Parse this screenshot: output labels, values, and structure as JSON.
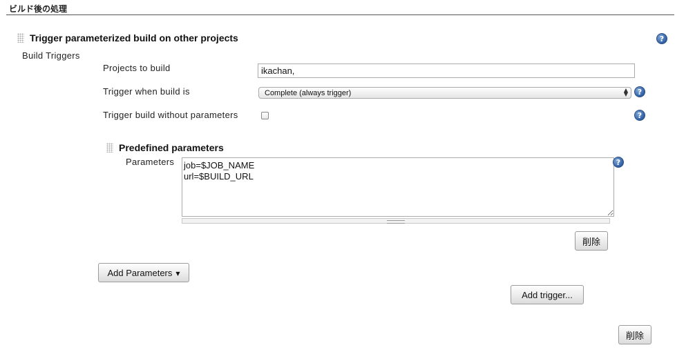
{
  "section": {
    "title": "ビルド後の処理"
  },
  "trigger_block": {
    "heading": "Trigger parameterized build on other projects",
    "subheading": "Build Triggers",
    "help_icon": "?",
    "projects": {
      "label": "Projects to build",
      "value": "ikachan,"
    },
    "trigger_when": {
      "label": "Trigger when build is",
      "selected": "Complete (always trigger)",
      "arrows": "▲▼"
    },
    "without_params": {
      "label": "Trigger build without parameters",
      "checked": false
    },
    "predefined": {
      "heading": "Predefined parameters",
      "parameters_label": "Parameters",
      "parameters_value": "job=$JOB_NAME\nurl=$BUILD_URL",
      "delete_label": "削除"
    },
    "add_parameters_label": "Add Parameters",
    "add_parameters_caret": "▼",
    "add_trigger_label": "Add trigger...",
    "delete_label": "削除"
  },
  "colors": {
    "help_icon": "#2f5fa3",
    "rule": "#555555"
  }
}
